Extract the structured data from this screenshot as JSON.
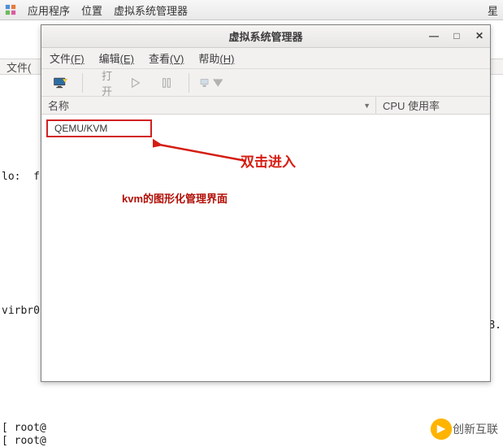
{
  "taskbar": {
    "app_menu": "应用程序",
    "locations": "位置",
    "active_app": "虚拟系统管理器",
    "clock_partial": "星"
  },
  "background": {
    "outer_menu_file": "文件(",
    "terminal_lines": {
      "lo": "lo:  fl",
      "virbr": "virbr0",
      "ipfrag": "8.",
      "root1": "[ root@",
      "root2": "[ root@"
    }
  },
  "vmm": {
    "title": "虚拟系统管理器",
    "window": {
      "minimize": "—",
      "maximize": "□",
      "close": "✕"
    },
    "menu": {
      "file": {
        "label": "文件",
        "hotkey": "(F)"
      },
      "edit": {
        "label": "编辑",
        "hotkey": "(E)"
      },
      "view": {
        "label": "查看",
        "hotkey": "(V)"
      },
      "help": {
        "label": "帮助",
        "hotkey": "(H)"
      }
    },
    "toolbar": {
      "open_label": "打开"
    },
    "columns": {
      "name": "名称",
      "cpu": "CPU 使用率"
    },
    "connection": "QEMU/KVM"
  },
  "annotations": {
    "double_click": "双击进入",
    "caption": "kvm的图形化管理界面"
  },
  "watermark": "创新互联"
}
